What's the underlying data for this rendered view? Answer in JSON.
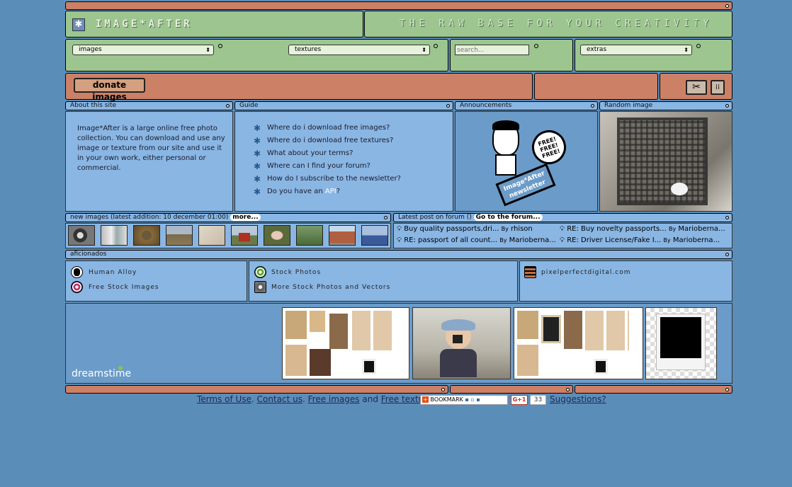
{
  "header": {
    "logo_text": "IMAGE*AFTER",
    "tagline": "THE RAW BASE FOR YOUR CREATIVITY"
  },
  "nav": {
    "select_images": "images",
    "select_textures": "textures",
    "search_placeholder": "search...",
    "select_extras": "extras"
  },
  "toolbar": {
    "donate_label": "donate images"
  },
  "about": {
    "title": "About this site",
    "text": "Image*After is a large online free photo collection. You can download and use any image or texture from our site and use it in your own work, either personal or commercial."
  },
  "guide": {
    "title": "Guide",
    "items": [
      "Where do i download free images?",
      "Where do i download free textures?",
      "What about your terms?",
      "Where can I find your forum?",
      "How do I subscribe to the newsletter?"
    ],
    "last_prefix": "Do you have an ",
    "last_link": "API",
    "last_suffix": "?"
  },
  "announcements": {
    "title": "Announcements",
    "badge_free": "FREE! FREE! FREE!",
    "sign_text": "Image*After newsletter"
  },
  "random": {
    "title": "Random image"
  },
  "new_images": {
    "title": "new images (latest addition: 10 december 01:00)",
    "more": "more..."
  },
  "forum": {
    "title": "Latest post on forum ()",
    "go": "Go to the forum...",
    "posts": [
      {
        "title": "Buy quality passports,dri...",
        "by": "By",
        "author": "rhison"
      },
      {
        "title": "RE: Buy novelty passports...",
        "by": "By",
        "author": "Marioberna..."
      },
      {
        "title": "RE: passport of all count...",
        "by": "By",
        "author": "Marioberna..."
      },
      {
        "title": "RE: Driver License/Fake I...",
        "by": "By",
        "author": "Marioberna..."
      }
    ]
  },
  "aficionados": {
    "title": "aficionados",
    "links": [
      "Human Alloy",
      "Free Stock Images",
      "Stock Photos",
      "More Stock Photos and Vectors",
      "pixelperfectdigital.com"
    ]
  },
  "ad": {
    "brand": "dreamstime"
  },
  "footer": {
    "terms": "Terms of Use",
    "sep1": ".",
    "contact": "Contact us",
    "sep2": ".",
    "free_images": "Free images",
    "and": "and",
    "free_textures": "Free textures",
    "bookmark": "BOOKMARK",
    "gplus": "G+1",
    "gplus_count": "33",
    "suggestions": "Suggestions?"
  },
  "colors": {
    "background": "#5b8db9",
    "orange": "#cc8066",
    "green": "#9dc58f",
    "light_blue": "#8ab6e4"
  }
}
